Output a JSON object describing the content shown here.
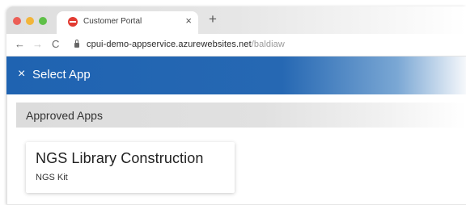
{
  "browser": {
    "traffic_lights": [
      "close",
      "minimize",
      "zoom"
    ],
    "tab": {
      "title": "Customer Portal",
      "favicon": "app-logo-icon",
      "close_glyph": "×"
    },
    "new_tab_glyph": "+",
    "nav": {
      "back_glyph": "←",
      "forward_glyph": "→",
      "reload_glyph": "C"
    },
    "url": {
      "host": "cpui-demo-appservice.azurewebsites.net",
      "path": "/baldiaw"
    }
  },
  "header": {
    "close_glyph": "×",
    "title": "Select App",
    "color": "#1f63b1"
  },
  "section": {
    "title": "Approved Apps"
  },
  "apps": [
    {
      "name": "NGS Library Construction",
      "kit": "NGS Kit"
    }
  ]
}
